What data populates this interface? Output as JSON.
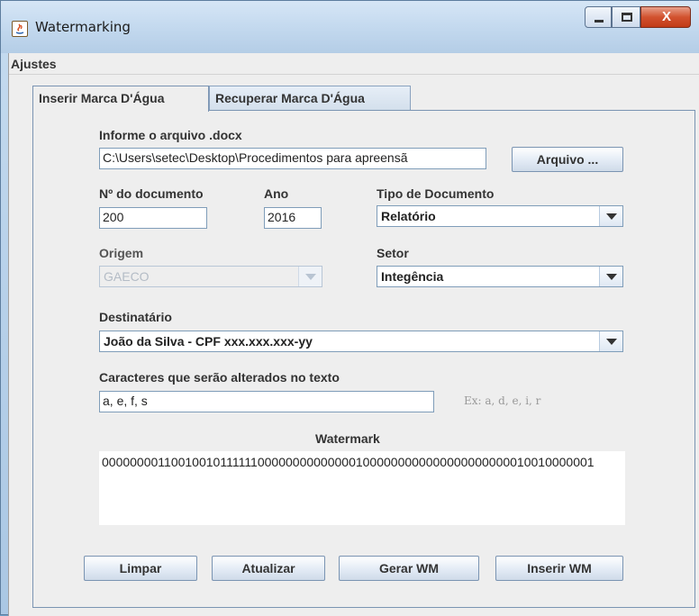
{
  "window": {
    "title": "Watermarking",
    "close_glyph": "X"
  },
  "menu": {
    "items": [
      "Ajustes"
    ]
  },
  "tabs": [
    {
      "label": "Inserir Marca D'Água",
      "active": true
    },
    {
      "label": "Recuperar Marca D'Água",
      "active": false
    }
  ],
  "form": {
    "file_label": "Informe o arquivo .docx",
    "file_value": "C:\\Users\\setec\\Desktop\\Procedimentos para apreensã",
    "file_button": "Arquivo ...",
    "doc_number_label": "Nº do documento",
    "doc_number_value": "200",
    "year_label": "Ano",
    "year_value": "2016",
    "doc_type_label": "Tipo de Documento",
    "doc_type_value": "Relatório",
    "origin_label": "Origem",
    "origin_value": "GAECO",
    "sector_label": "Setor",
    "sector_value": "Integência",
    "recipient_label": "Destinatário",
    "recipient_value": "João da Silva - CPF xxx.xxx.xxx-yy",
    "chars_label": "Caracteres que serão alterados no texto",
    "chars_value": "a, e, f, s",
    "chars_hint": "Ex: a, d, e, i, r",
    "watermark_label": "Watermark",
    "watermark_value": "00000000110010010111111000000000000001000000000000000000000010010000001"
  },
  "buttons": {
    "clear": "Limpar",
    "update": "Atualizar",
    "generate": "Gerar WM",
    "insert": "Inserir WM"
  },
  "icons": [
    "java-app-icon",
    "minimize-icon",
    "maximize-icon",
    "close-icon",
    "dropdown-arrow-icon"
  ],
  "colors": {
    "title_bar": "#c2d8ee",
    "close_button": "#d2522f",
    "panel_bg": "#eeeeee",
    "field_border": "#7f9db9"
  }
}
